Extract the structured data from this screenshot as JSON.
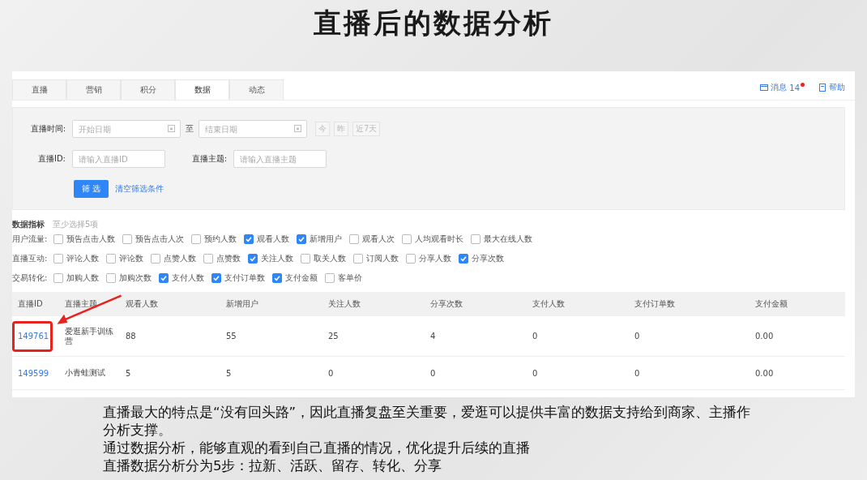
{
  "slide_title": "直播后的数据分析",
  "tabs": [
    {
      "label": "直播",
      "selected": false
    },
    {
      "label": "营销",
      "selected": false
    },
    {
      "label": "积分",
      "selected": false
    },
    {
      "label": "数据",
      "selected": true
    },
    {
      "label": "动态",
      "selected": false
    }
  ],
  "header_links": {
    "messages": {
      "label": "消息",
      "count": "14",
      "unread": true
    },
    "help": {
      "label": "帮助"
    }
  },
  "filter": {
    "time_label": "直播时间:",
    "start_placeholder": "开始日期",
    "range_separator": "至",
    "end_placeholder": "结束日期",
    "quick_buttons": [
      {
        "label": "今",
        "disabled": true
      },
      {
        "label": "昨",
        "disabled": true
      },
      {
        "label": "近7天",
        "disabled": true
      }
    ],
    "id_label": "直播ID:",
    "id_placeholder": "请输入直播ID",
    "topic_label": "直播主题:",
    "topic_placeholder": "请输入直播主题",
    "submit": "筛 选",
    "clear": "清空筛选条件"
  },
  "metrics": {
    "title": "数据指标",
    "hint": "至少选择5项",
    "groups": [
      {
        "label": "用户流量:",
        "items": [
          {
            "label": "预告点击人数",
            "checked": false
          },
          {
            "label": "预告点击人次",
            "checked": false
          },
          {
            "label": "预约人数",
            "checked": false
          },
          {
            "label": "观看人数",
            "checked": true
          },
          {
            "label": "新增用户",
            "checked": true
          },
          {
            "label": "观看人次",
            "checked": false
          },
          {
            "label": "人均观看时长",
            "checked": false
          },
          {
            "label": "最大在线人数",
            "checked": false
          }
        ]
      },
      {
        "label": "直播互动:",
        "items": [
          {
            "label": "评论人数",
            "checked": false
          },
          {
            "label": "评论数",
            "checked": false
          },
          {
            "label": "点赞人数",
            "checked": false
          },
          {
            "label": "点赞数",
            "checked": false
          },
          {
            "label": "关注人数",
            "checked": true
          },
          {
            "label": "取关人数",
            "checked": false
          },
          {
            "label": "订阅人数",
            "checked": false
          },
          {
            "label": "分享人数",
            "checked": false
          },
          {
            "label": "分享次数",
            "checked": true
          }
        ]
      },
      {
        "label": "交易转化:",
        "items": [
          {
            "label": "加购人数",
            "checked": false
          },
          {
            "label": "加购次数",
            "checked": false
          },
          {
            "label": "支付人数",
            "checked": true
          },
          {
            "label": "支付订单数",
            "checked": true
          },
          {
            "label": "支付金额",
            "checked": true
          },
          {
            "label": "客单价",
            "checked": false
          }
        ]
      }
    ]
  },
  "table": {
    "columns": [
      "直播ID",
      "直播主题",
      "观看人数",
      "新增用户",
      "关注人数",
      "分享次数",
      "支付人数",
      "支付订单数",
      "支付金额"
    ],
    "rows": [
      {
        "highlighted": true,
        "cells": [
          "149761",
          "爱逛新手训练营",
          "88",
          "55",
          "25",
          "4",
          "0",
          "0",
          "0.00"
        ]
      },
      {
        "highlighted": false,
        "cells": [
          "149599",
          "小青蛙测试",
          "5",
          "5",
          "0",
          "0",
          "0",
          "0",
          "0.00"
        ]
      }
    ]
  },
  "caption": [
    "直播最大的特点是“没有回头路”，因此直播复盘至关重要，爱逛可以提供丰富的数据支持给到商家、主播作分析支撑。",
    "通过数据分析，能够直观的看到自己直播的情况，优化提升后续的直播",
    "直播数据分析分为5步：拉新、活跃、留存、转化、分享"
  ]
}
